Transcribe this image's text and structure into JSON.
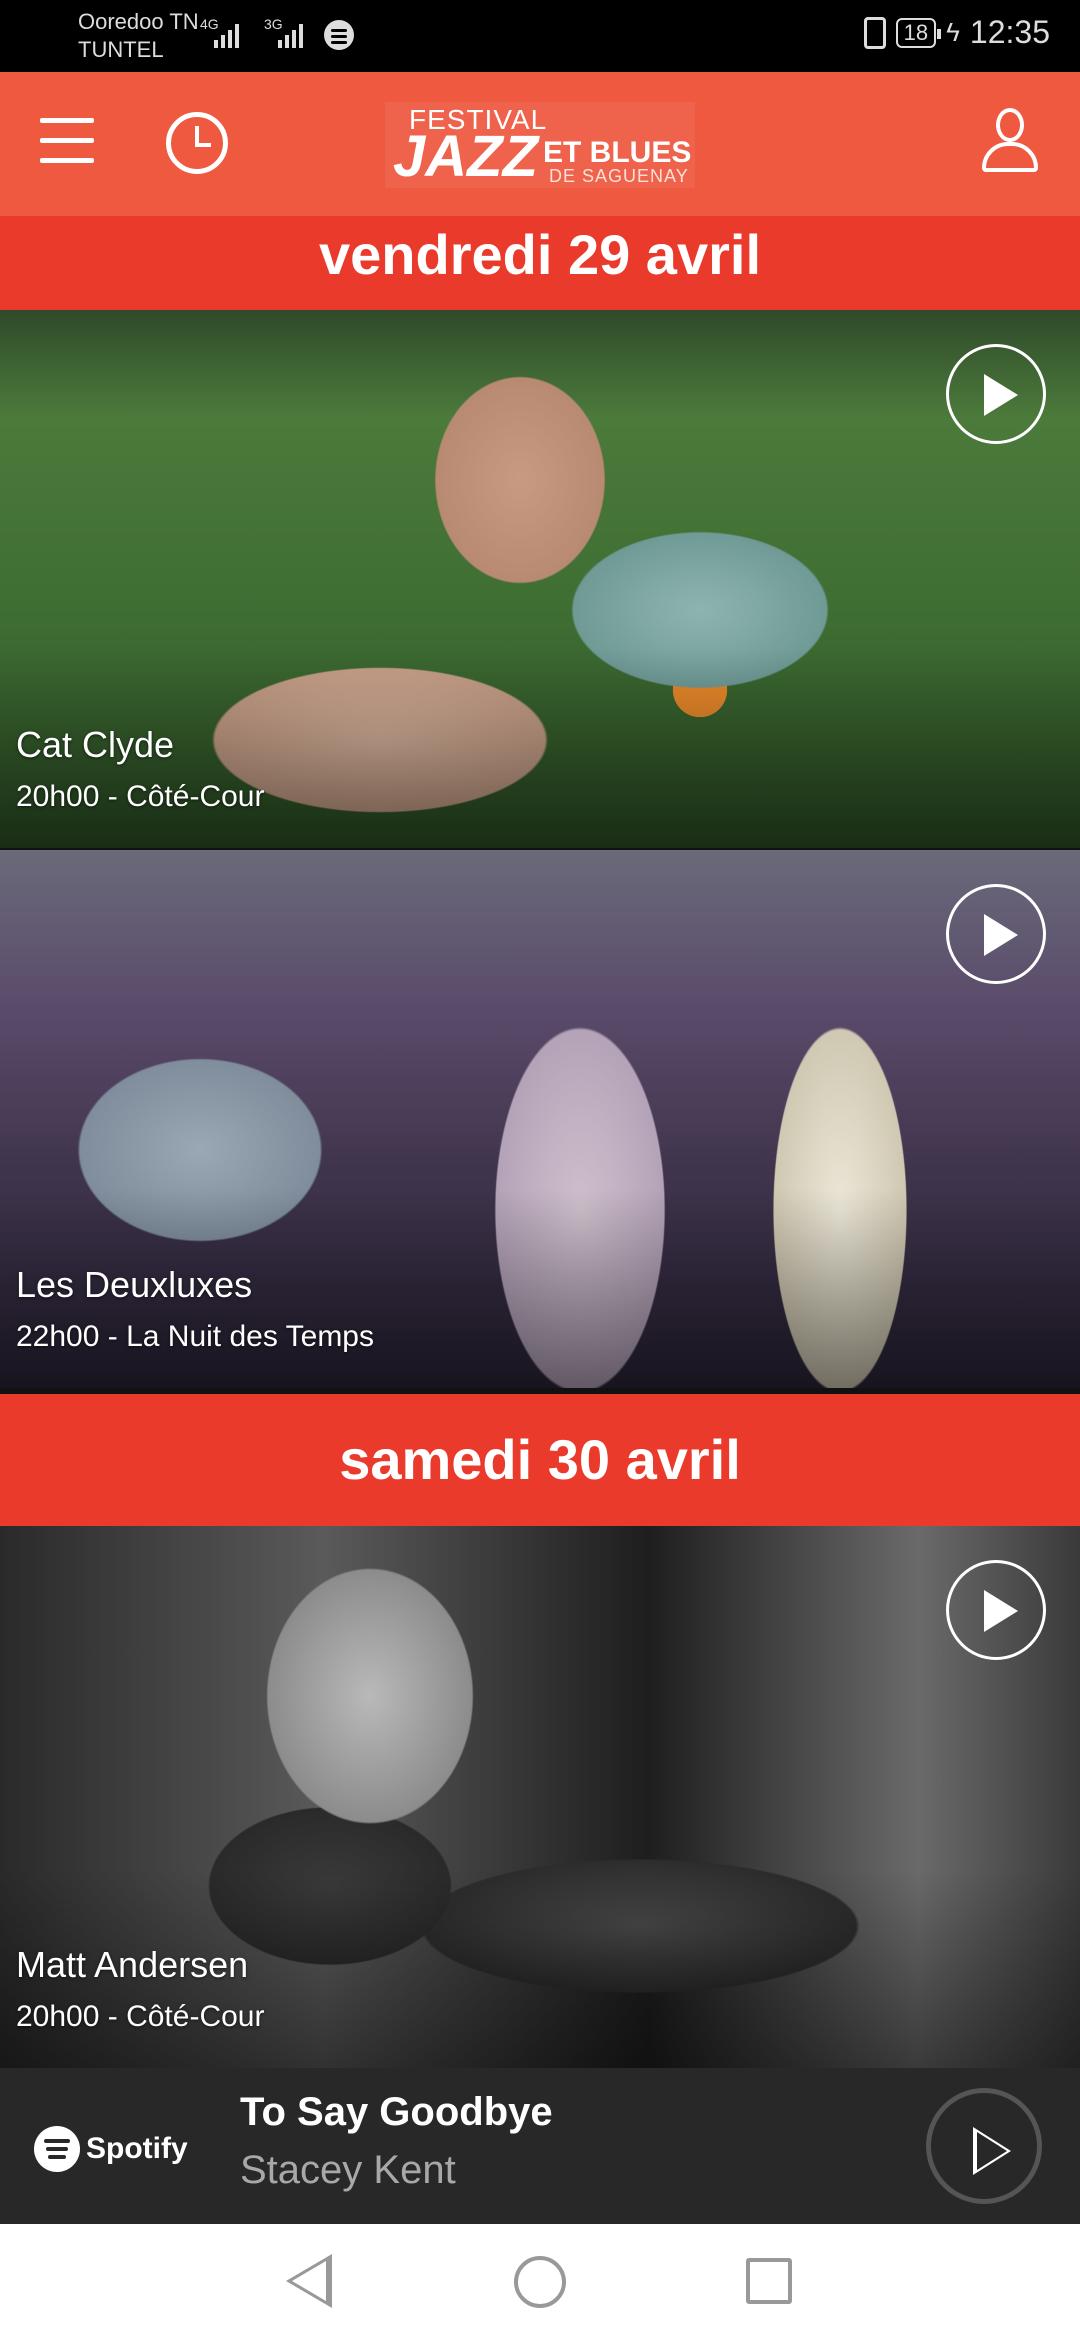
{
  "status_bar": {
    "carrier_1": "Ooredoo TN",
    "carrier_2": "TUNTEL",
    "network_1": "4G",
    "network_2": "3G",
    "battery": "18",
    "time": "12:35"
  },
  "header": {
    "logo_line1": "FESTIVAL",
    "logo_main": "JAZZ",
    "logo_side": "ET BLUES",
    "logo_sub": "DE SAGUENAY",
    "accent_color": "#ee5940"
  },
  "feed": {
    "days": [
      {
        "label": "vendredi 29 avril",
        "events": [
          {
            "artist": "Cat Clyde",
            "details": "20h00 - Côté-Cour"
          },
          {
            "artist": "Les Deuxluxes",
            "details": "22h00 - La Nuit des Temps"
          }
        ]
      },
      {
        "label": "samedi 30 avril",
        "events": [
          {
            "artist": "Matt Andersen",
            "details": "20h00 - Côté-Cour"
          }
        ]
      }
    ],
    "day_header_color": "#ea3a2c"
  },
  "player": {
    "brand": "Spotify",
    "track_title": "To Say Goodbye",
    "track_artist": "Stacey Kent",
    "background_color": "#282828"
  },
  "icons": {
    "menu": "hamburger-icon",
    "schedule": "clock-icon",
    "account": "user-icon",
    "play": "play-icon",
    "nav_back": "back-triangle-icon",
    "nav_home": "home-circle-icon",
    "nav_recents": "recents-square-icon"
  }
}
